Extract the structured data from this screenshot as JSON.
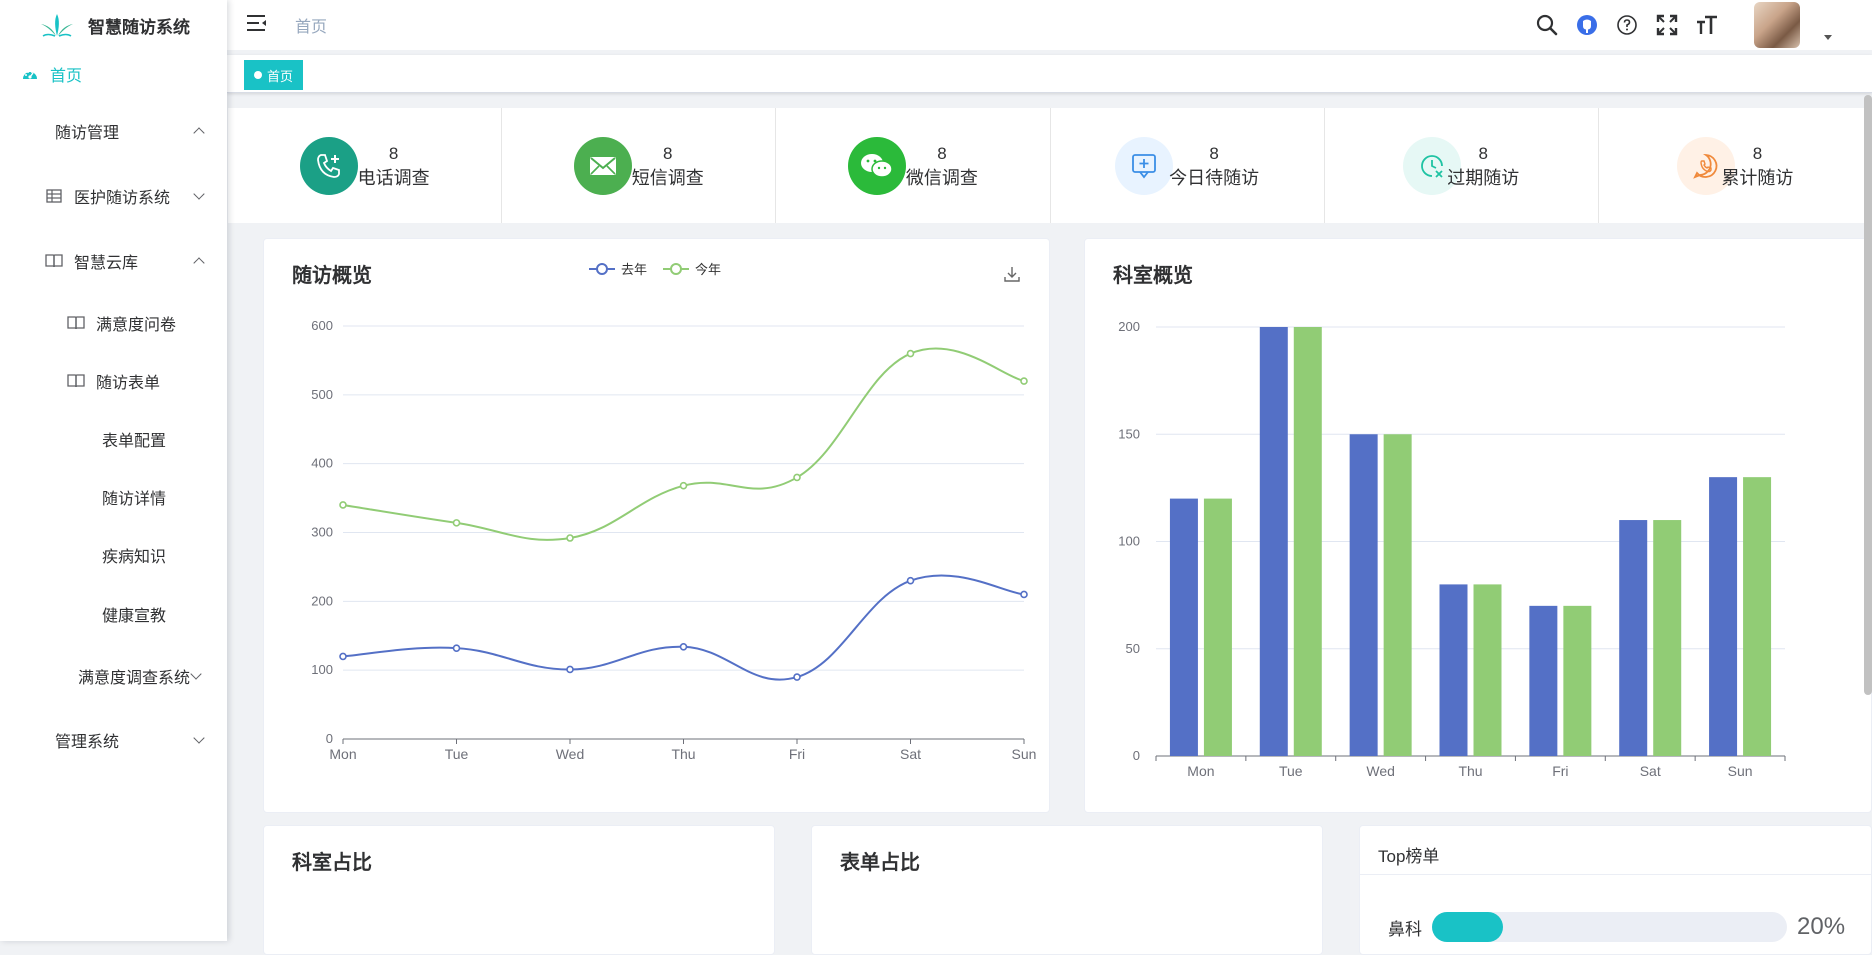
{
  "app": {
    "title": "智慧随访系统"
  },
  "sidebar": {
    "items": [
      {
        "label": "首页",
        "icon": "dashboard-icon",
        "active": true
      },
      {
        "label": "随访管理",
        "expanded": true
      },
      {
        "label": "医护随访系统",
        "icon": "table-grid-icon",
        "expanded": false
      },
      {
        "label": "智慧云库",
        "icon": "book-icon",
        "expanded": true
      },
      {
        "label": "满意度问卷",
        "icon": "book-icon"
      },
      {
        "label": "随访表单",
        "icon": "book-icon"
      },
      {
        "label": "表单配置"
      },
      {
        "label": "随访详情"
      },
      {
        "label": "疾病知识"
      },
      {
        "label": "健康宣教"
      },
      {
        "label": "满意度调查系统",
        "expanded": false
      },
      {
        "label": "管理系统",
        "expanded": false
      }
    ]
  },
  "header": {
    "breadcrumb": "首页",
    "tools": [
      "search-icon",
      "github-icon",
      "help-icon",
      "fullscreen-icon",
      "font-size-icon"
    ]
  },
  "tags": {
    "active": "首页"
  },
  "stats": [
    {
      "value": "8",
      "label": "电话调查",
      "icon": "phone-icon",
      "color": "#1ba086"
    },
    {
      "value": "8",
      "label": "短信调查",
      "icon": "mail-icon",
      "color": "#4caf50"
    },
    {
      "value": "8",
      "label": "微信调查",
      "icon": "wechat-icon",
      "color": "#2bba3a"
    },
    {
      "value": "8",
      "label": "今日待随访",
      "icon": "add-chat-icon",
      "color": "#e8f3ff"
    },
    {
      "value": "8",
      "label": "过期随访",
      "icon": "clock-x-icon",
      "color": "#e6f8f5"
    },
    {
      "value": "8",
      "label": "累计随访",
      "icon": "phone-bubble-icon",
      "color": "#fff1e6"
    }
  ],
  "cards": {
    "overview": {
      "title": "随访概览"
    },
    "dept": {
      "title": "科室概览"
    },
    "dept_ratio": {
      "title": "科室占比"
    },
    "form_ratio": {
      "title": "表单占比"
    },
    "top": {
      "title": "Top榜单",
      "rows": [
        {
          "label": "鼻科",
          "percent": 20,
          "percent_text": "20%"
        }
      ]
    }
  },
  "colors": {
    "accent": "#19c2c6",
    "series_blue": "#5470c6",
    "series_green": "#91cc75"
  },
  "chart_data": [
    {
      "type": "line",
      "title": "随访概览",
      "categories": [
        "Mon",
        "Tue",
        "Wed",
        "Thu",
        "Fri",
        "Sat",
        "Sun"
      ],
      "series": [
        {
          "name": "去年",
          "values": [
            120,
            132,
            101,
            134,
            90,
            230,
            210
          ]
        },
        {
          "name": "今年",
          "values": [
            340,
            314,
            292,
            368,
            380,
            560,
            520
          ]
        }
      ],
      "ylim": [
        0,
        600
      ],
      "yticks": [
        0,
        100,
        200,
        300,
        400,
        500,
        600
      ],
      "smooth": true,
      "legend": "top-center",
      "grid": true
    },
    {
      "type": "bar",
      "title": "科室概览",
      "categories": [
        "Mon",
        "Tue",
        "Wed",
        "Thu",
        "Fri",
        "Sat",
        "Sun"
      ],
      "series": [
        {
          "values": [
            120,
            200,
            150,
            80,
            70,
            110,
            130
          ]
        },
        {
          "values": [
            120,
            200,
            150,
            80,
            70,
            110,
            130
          ]
        }
      ],
      "ylim": [
        0,
        200
      ],
      "yticks": [
        0,
        50,
        100,
        150,
        200
      ],
      "grid": true
    }
  ]
}
